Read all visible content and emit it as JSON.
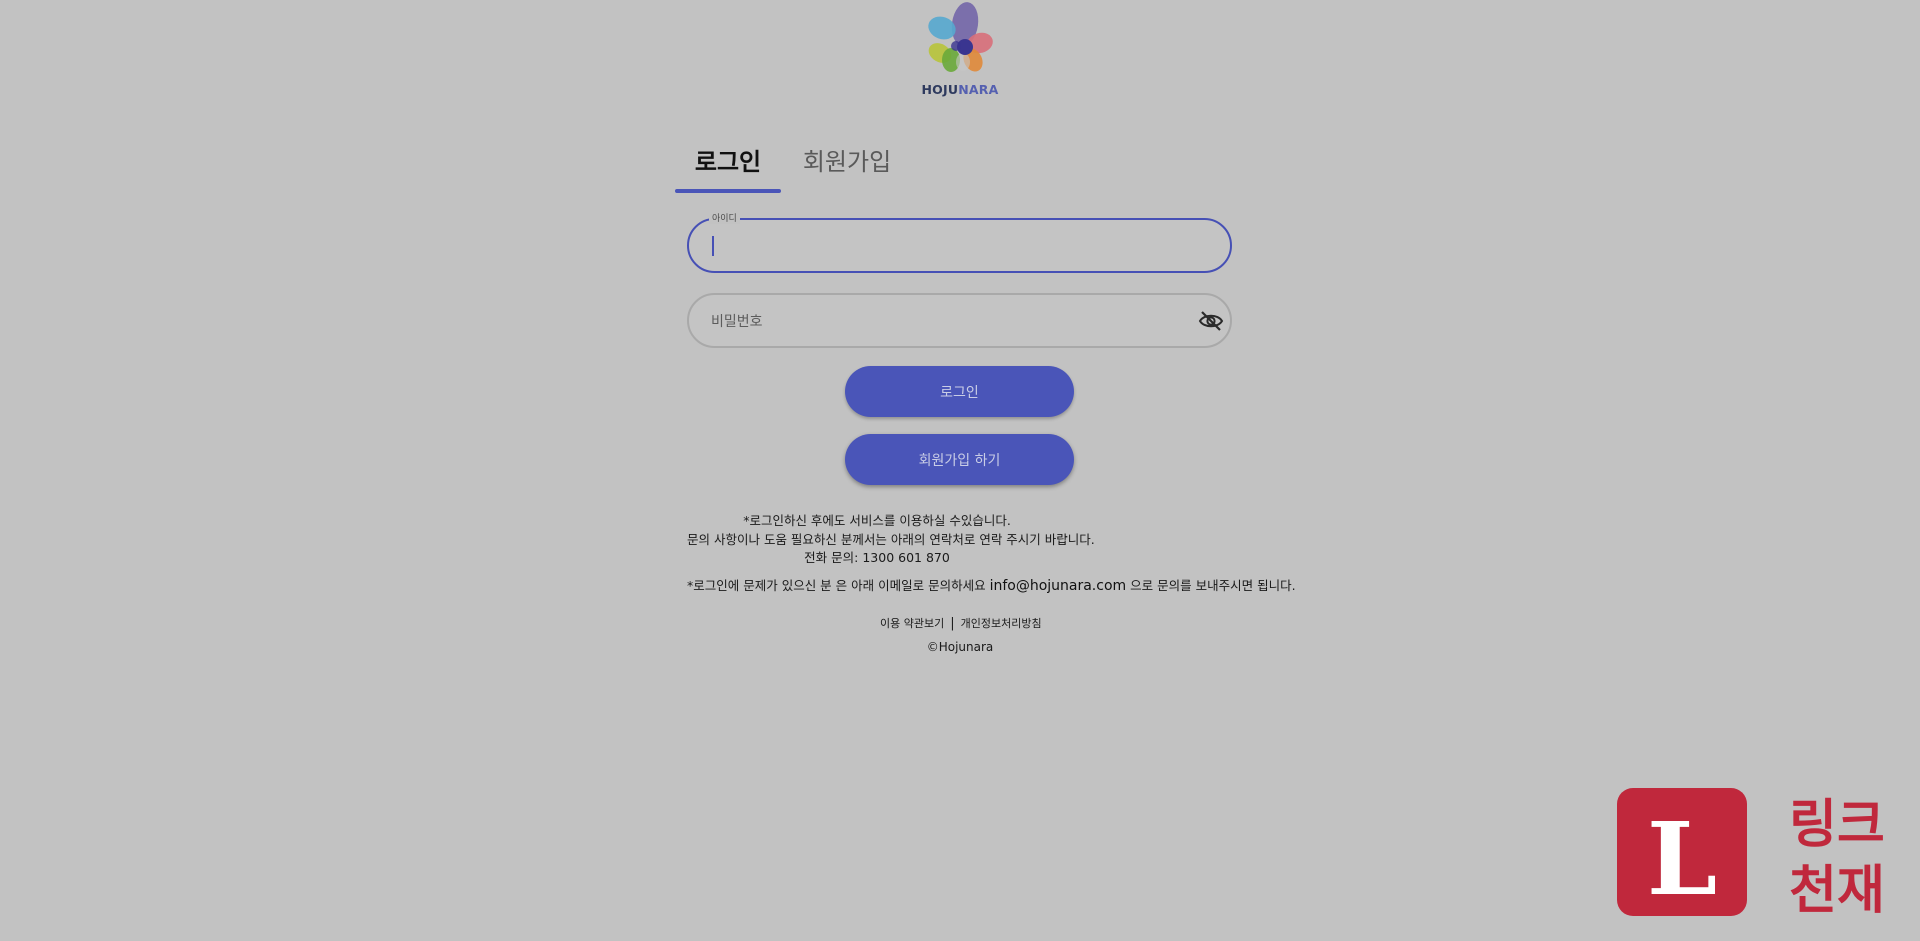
{
  "brand": {
    "name_part1": "HOJU",
    "name_part2": "NARA"
  },
  "tabs": [
    {
      "label": "로그인",
      "active": true
    },
    {
      "label": "회원가입",
      "active": false
    }
  ],
  "form": {
    "username_label": "아이디",
    "username_value": "",
    "password_placeholder": "비밀번호"
  },
  "buttons": {
    "login": "로그인",
    "signup": "회원가입 하기"
  },
  "info": {
    "line1": "*로그인하신 후에도 서비스를 이용하실 수있습니다.",
    "line2": "문의 사항이나 도움 필요하신 분께서는 아래의 연락처로 연락 주시기 바랍니다.",
    "phone_label": "전화 문의:",
    "phone": "1300 601 870"
  },
  "note": {
    "prefix": "*로그인에 문제가 있으신 분 은 아래 이메일로 문의하세요",
    "email": "info@hojunara.com",
    "suffix": "으로 문의를 보내주시면 됩니다."
  },
  "footer": {
    "terms": "이용 약관보기",
    "separator": "|",
    "privacy": "개인정보처리방침",
    "copyright": "©Hojunara"
  },
  "badge": {
    "letter": "L",
    "text_line1": "링크",
    "text_line2": "천재"
  },
  "colors": {
    "accent": "#4a55b8",
    "background": "#c2c2c2",
    "badge_red": "#c0283c"
  },
  "icons": [
    "eye-slash-icon"
  ]
}
